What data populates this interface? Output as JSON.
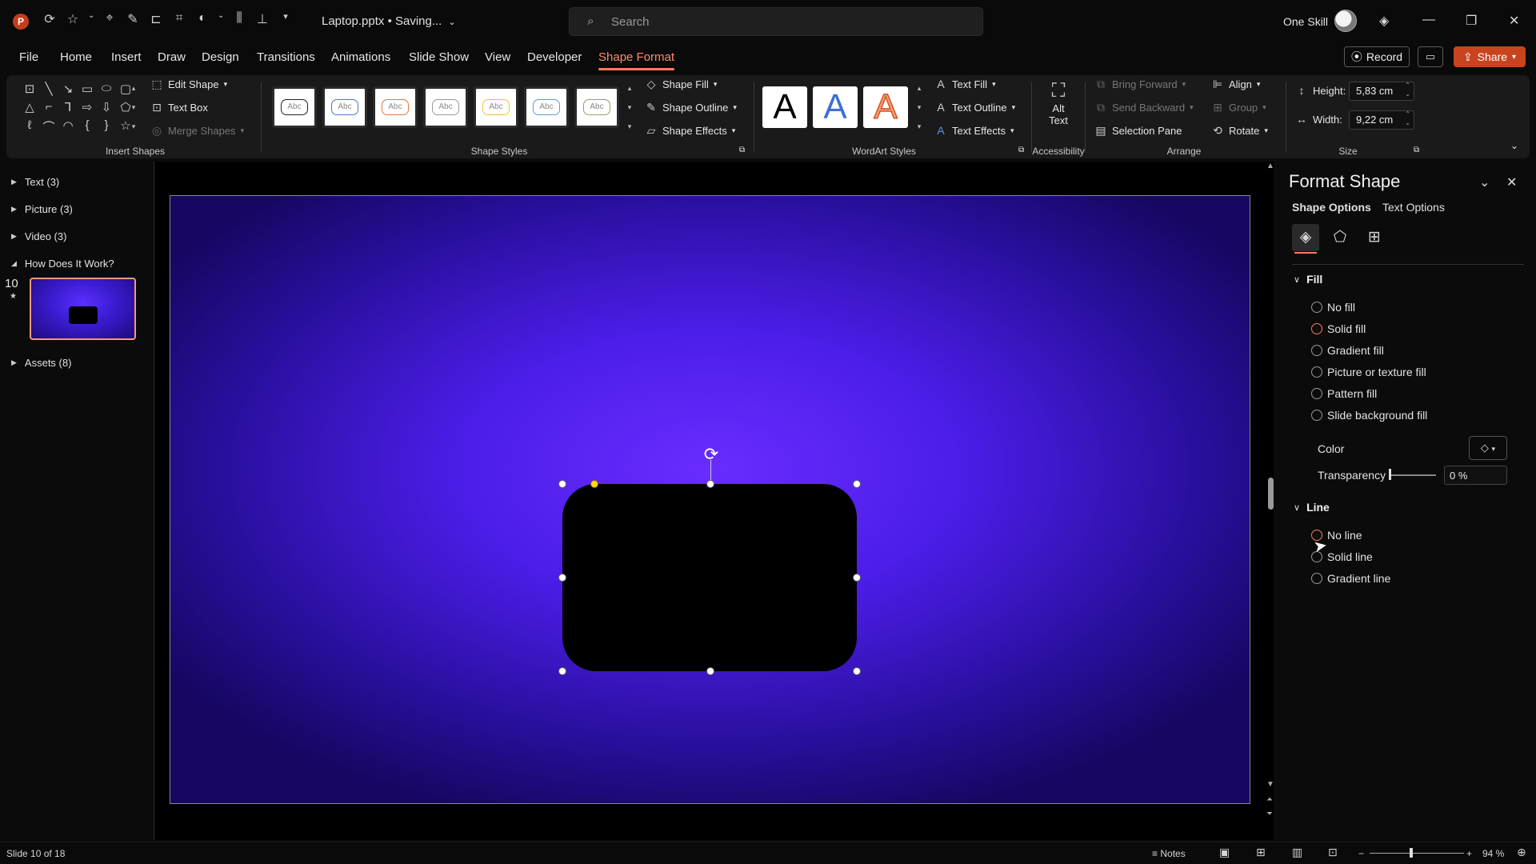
{
  "titlebar": {
    "app_initial": "P",
    "quick_access": [
      "autosave-icon",
      "star-icon",
      "chevron-down-icon",
      "lasso-icon",
      "pen-icon",
      "align-icon",
      "crop-icon",
      "shape-icon",
      "chevron-down-icon",
      "distribute-icon",
      "distribute-v-icon",
      "more-icon"
    ],
    "document_title": "Laptop.pptx • Saving...",
    "search_placeholder": "Search",
    "user_name": "One Skill"
  },
  "menu": {
    "tabs": [
      "File",
      "Home",
      "Insert",
      "Draw",
      "Design",
      "Transitions",
      "Animations",
      "Slide Show",
      "View",
      "Developer",
      "Shape Format"
    ],
    "active_tab": "Shape Format",
    "record_label": "Record",
    "share_label": "Share"
  },
  "ribbon": {
    "insert_shapes": {
      "edit_shape": "Edit Shape",
      "text_box": "Text Box",
      "merge_shapes": "Merge Shapes",
      "label": "Insert Shapes"
    },
    "shape_styles": {
      "swatch_text": "Abc",
      "swatch_colors": [
        "#222222",
        "#4e79c7",
        "#e07a3c",
        "#999999",
        "#f2c12e",
        "#5b9bd5",
        "#8aaa5a"
      ],
      "shape_fill": "Shape Fill",
      "shape_outline": "Shape Outline",
      "shape_effects": "Shape Effects",
      "label": "Shape Styles"
    },
    "wordart_styles": {
      "letter": "A",
      "text_fill": "Text Fill",
      "text_outline": "Text Outline",
      "text_effects": "Text Effects",
      "label": "WordArt Styles"
    },
    "accessibility": {
      "alt_text_line1": "Alt",
      "alt_text_line2": "Text",
      "label": "Accessibility"
    },
    "arrange": {
      "bring_forward": "Bring Forward",
      "send_backward": "Send Backward",
      "selection_pane": "Selection Pane",
      "align": "Align",
      "group": "Group",
      "rotate": "Rotate",
      "label": "Arrange"
    },
    "size": {
      "height_label": "Height:",
      "height_value": "5,83 cm",
      "width_label": "Width:",
      "width_value": "9,22 cm",
      "label": "Size"
    }
  },
  "slides_pane": {
    "sections": [
      {
        "label": "Text (3)",
        "expanded": false
      },
      {
        "label": "Picture (3)",
        "expanded": false
      },
      {
        "label": "Video (3)",
        "expanded": false
      },
      {
        "label": "How Does It Work?",
        "expanded": true
      },
      {
        "label": "Assets (8)",
        "expanded": false
      }
    ],
    "current_slide_number": "10",
    "slide_star": "★"
  },
  "format_pane": {
    "title": "Format Shape",
    "tabs": [
      "Shape Options",
      "Text Options"
    ],
    "fill": {
      "title": "Fill",
      "options": [
        "No fill",
        "Solid fill",
        "Gradient fill",
        "Picture or texture fill",
        "Pattern fill",
        "Slide background fill"
      ],
      "selected": "Solid fill",
      "color_label": "Color",
      "transparency_label": "Transparency",
      "transparency_value": "0 %",
      "transparency_fraction": 0
    },
    "line": {
      "title": "Line",
      "options": [
        "No line",
        "Solid line",
        "Gradient line"
      ],
      "hovered": "No line"
    }
  },
  "statusbar": {
    "slide_info": "Slide 10 of 18",
    "notes_label": "Notes",
    "zoom_minus": "−",
    "zoom_plus": "+",
    "zoom_value": "94 %"
  },
  "colors": {
    "accent": "#ff7c5c",
    "share_button": "#c8441f",
    "slide_background_center": "#6a2cff",
    "slide_background_edge": "#170763",
    "shape_fill": "#000000"
  }
}
